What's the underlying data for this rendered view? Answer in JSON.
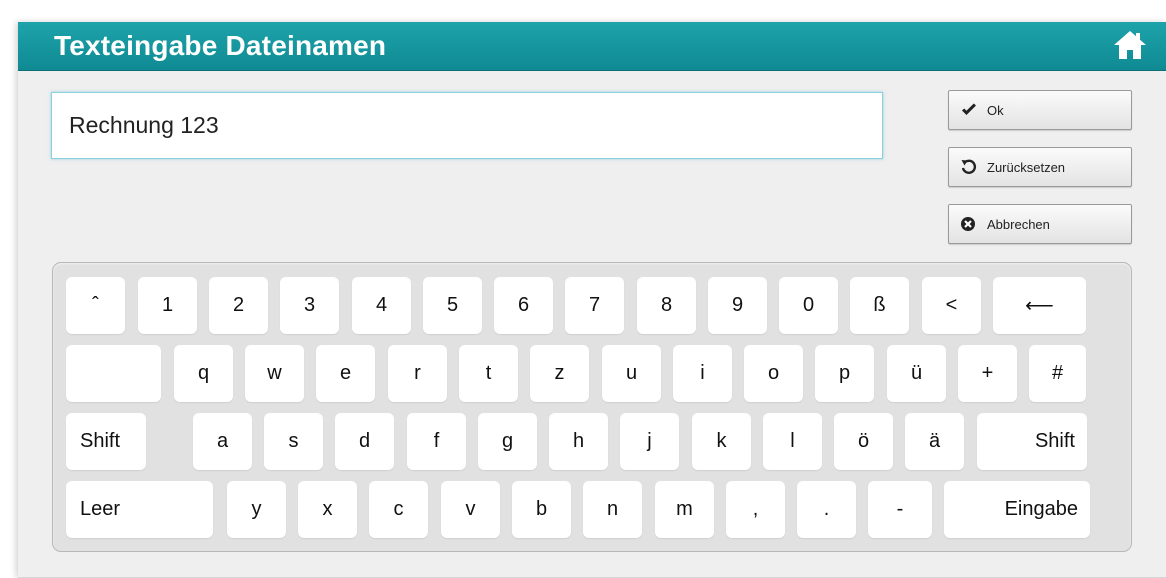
{
  "window": {
    "title": "Texteingabe Dateinamen"
  },
  "input": {
    "value": "Rechnung 123"
  },
  "buttons": {
    "ok": "Ok",
    "reset": "Zurücksetzen",
    "cancel": "Abbrechen"
  },
  "keyboard": {
    "rows": [
      [
        "ˆ",
        "1",
        "2",
        "3",
        "4",
        "5",
        "6",
        "7",
        "8",
        "9",
        "0",
        "ß",
        "<",
        "⟵"
      ],
      [
        "",
        "q",
        "w",
        "e",
        "r",
        "t",
        "z",
        "u",
        "i",
        "o",
        "p",
        "ü",
        "+",
        "#"
      ],
      [
        "Shift",
        "a",
        "s",
        "d",
        "f",
        "g",
        "h",
        "j",
        "k",
        "l",
        "ö",
        "ä",
        "Shift"
      ],
      [
        "Leer",
        "y",
        "x",
        "c",
        "v",
        "b",
        "n",
        "m",
        ",",
        ".",
        "-",
        "Eingabe"
      ]
    ],
    "key_names": [
      [
        "key-circumflex",
        "key-1",
        "key-2",
        "key-3",
        "key-4",
        "key-5",
        "key-6",
        "key-7",
        "key-8",
        "key-9",
        "key-0",
        "key-eszett",
        "key-less-than",
        "key-backspace"
      ],
      [
        "key-tab",
        "key-q",
        "key-w",
        "key-e",
        "key-r",
        "key-t",
        "key-z",
        "key-u",
        "key-i",
        "key-o",
        "key-p",
        "key-u-umlaut",
        "key-plus",
        "key-hash"
      ],
      [
        "key-shift-left",
        "key-a",
        "key-s",
        "key-d",
        "key-f",
        "key-g",
        "key-h",
        "key-j",
        "key-k",
        "key-l",
        "key-o-umlaut",
        "key-a-umlaut",
        "key-shift-right"
      ],
      [
        "key-space",
        "key-y",
        "key-x",
        "key-c",
        "key-v",
        "key-b",
        "key-n",
        "key-m",
        "key-comma",
        "key-period",
        "key-minus",
        "key-enter"
      ]
    ]
  },
  "icons": {
    "home": "home-icon",
    "ok": "checkmark-icon",
    "reset": "undo-icon",
    "cancel": "close-circle-icon"
  },
  "colors": {
    "titlebar": "#1399a1",
    "title_text": "#ffffff",
    "input_border": "#8ad0e0"
  }
}
